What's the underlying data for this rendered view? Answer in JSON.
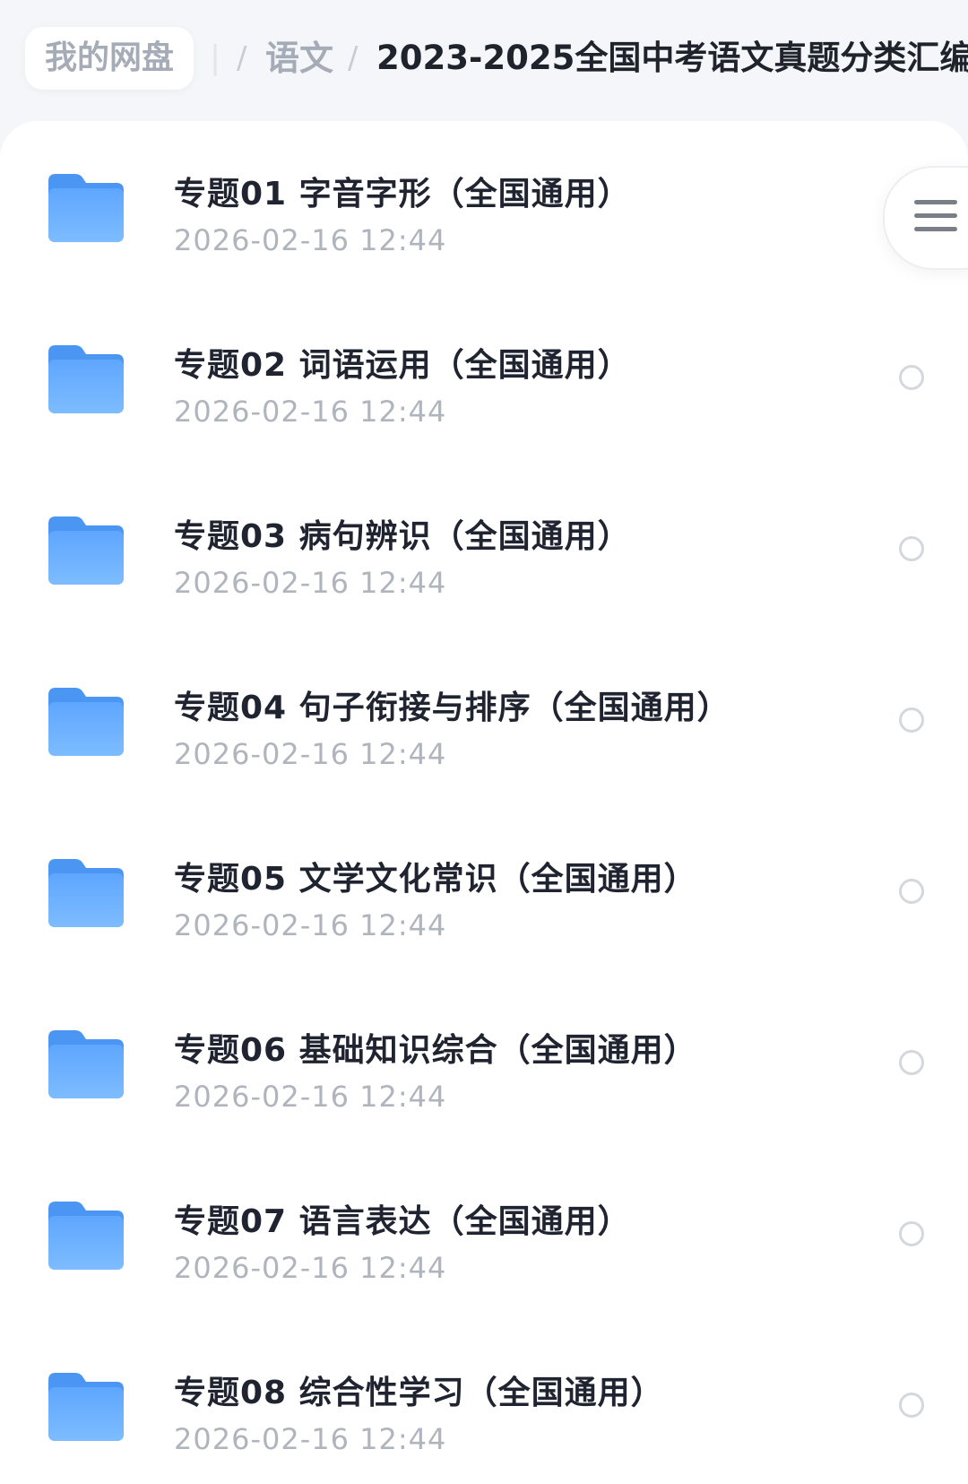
{
  "breadcrumb": {
    "home": "我的网盘",
    "ghost": "|",
    "separator": "/",
    "parent": "语文",
    "current": "2023-2025全国中考语文真题分类汇编"
  },
  "menu_button": {
    "icon": "hamburger-menu-icon"
  },
  "colors": {
    "folder_top": "#5ea6ff",
    "folder_bottom": "#7dbcff",
    "title": "#1f2430",
    "date": "#b0b5bd",
    "background": "#f4f6f9"
  },
  "files": [
    {
      "title": "专题01 字音字形（全国通用）",
      "date": "2026-02-16 12:44",
      "icon": "folder-icon"
    },
    {
      "title": "专题02 词语运用（全国通用）",
      "date": "2026-02-16 12:44",
      "icon": "folder-icon"
    },
    {
      "title": "专题03 病句辨识（全国通用）",
      "date": "2026-02-16 12:44",
      "icon": "folder-icon"
    },
    {
      "title": "专题04 句子衔接与排序（全国通用）",
      "date": "2026-02-16 12:44",
      "icon": "folder-icon"
    },
    {
      "title": "专题05 文学文化常识（全国通用）",
      "date": "2026-02-16 12:44",
      "icon": "folder-icon"
    },
    {
      "title": "专题06 基础知识综合（全国通用）",
      "date": "2026-02-16 12:44",
      "icon": "folder-icon"
    },
    {
      "title": "专题07 语言表达（全国通用）",
      "date": "2026-02-16 12:44",
      "icon": "folder-icon"
    },
    {
      "title": "专题08 综合性学习（全国通用）",
      "date": "2026-02-16 12:44",
      "icon": "folder-icon"
    }
  ]
}
